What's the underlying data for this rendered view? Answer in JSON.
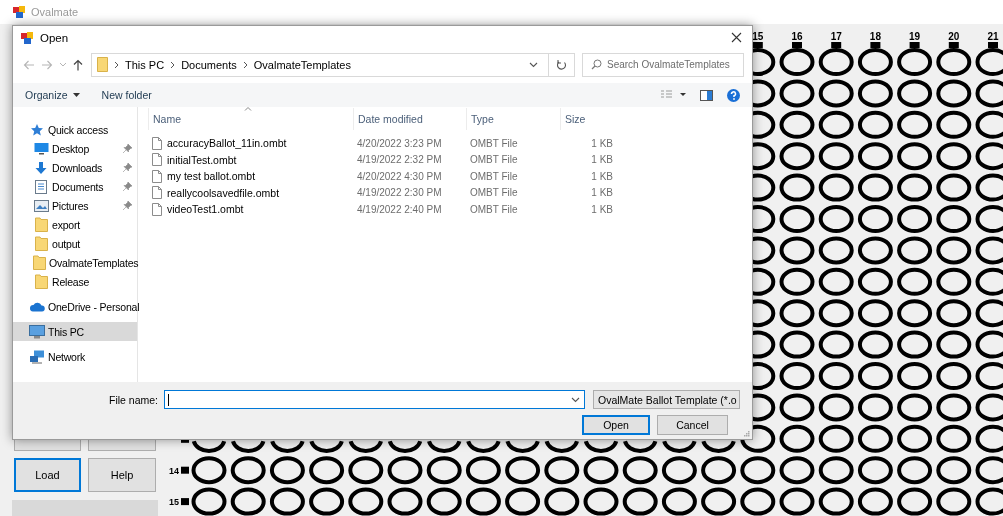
{
  "app": {
    "title": "Ovalmate",
    "grid": {
      "column_labels": [
        "15",
        "16",
        "17",
        "18",
        "19",
        "20",
        "21"
      ],
      "row_labels": [
        "14",
        "15"
      ]
    },
    "buttons": [
      {
        "label": "Load",
        "focused": true
      },
      {
        "label": "Help",
        "focused": false
      }
    ]
  },
  "dialog": {
    "title": "Open",
    "breadcrumb": [
      "This PC",
      "Documents",
      "OvalmateTemplates"
    ],
    "search": {
      "placeholder": "Search OvalmateTemplates"
    },
    "toolbar": [
      "Organize",
      "New folder"
    ],
    "nav": [
      {
        "label": "Quick access",
        "kind": "star",
        "selected": false,
        "children": [
          {
            "label": "Desktop",
            "kind": "desktop",
            "pinned": true,
            "selected": false
          },
          {
            "label": "Downloads",
            "kind": "downloads",
            "pinned": true,
            "selected": false
          },
          {
            "label": "Documents",
            "kind": "documents",
            "pinned": true,
            "selected": false
          },
          {
            "label": "Pictures",
            "kind": "pictures",
            "pinned": true,
            "selected": false
          },
          {
            "label": "export",
            "kind": "folder",
            "pinned": false,
            "selected": false
          },
          {
            "label": "output",
            "kind": "folder",
            "pinned": false,
            "selected": false
          },
          {
            "label": "OvalmateTemplates",
            "kind": "folder",
            "pinned": false,
            "selected": false
          },
          {
            "label": "Release",
            "kind": "folder",
            "pinned": false,
            "selected": false
          }
        ]
      },
      {
        "label": "OneDrive - Personal",
        "kind": "cloud",
        "selected": false
      },
      {
        "label": "This PC",
        "kind": "pc",
        "selected": true
      },
      {
        "label": "Network",
        "kind": "network",
        "selected": false
      }
    ],
    "columns": [
      "Name",
      "Date modified",
      "Type",
      "Size"
    ],
    "files": [
      {
        "name": "accuracyBallot_11in.ombt",
        "date": "4/20/2022 3:23 PM",
        "type": "OMBT File",
        "size": "1 KB"
      },
      {
        "name": "initialTest.ombt",
        "date": "4/19/2022 2:32 PM",
        "type": "OMBT File",
        "size": "1 KB"
      },
      {
        "name": "my test ballot.ombt",
        "date": "4/20/2022 4:30 PM",
        "type": "OMBT File",
        "size": "1 KB"
      },
      {
        "name": "reallycoolsavedfile.ombt",
        "date": "4/19/2022 2:30 PM",
        "type": "OMBT File",
        "size": "1 KB"
      },
      {
        "name": "videoTest1.ombt",
        "date": "4/19/2022 2:40 PM",
        "type": "OMBT File",
        "size": "1 KB"
      }
    ],
    "file_name_label": "File name:",
    "filter": "OvalMate Ballot Template (*.o",
    "buttons": [
      {
        "label": "Open",
        "default": true
      },
      {
        "label": "Cancel",
        "default": false
      }
    ]
  }
}
